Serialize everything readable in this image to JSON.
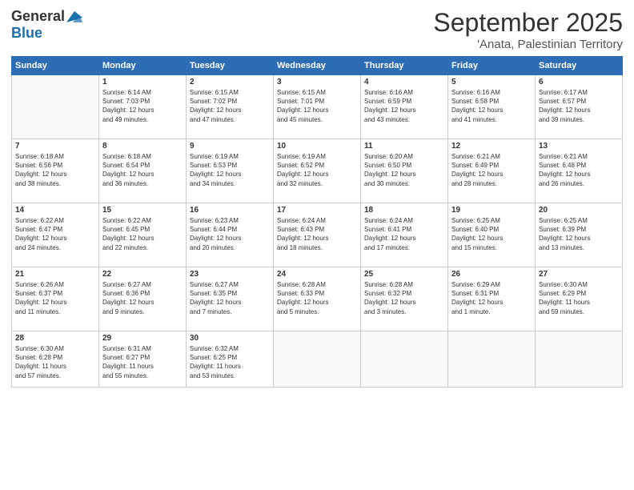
{
  "logo": {
    "general": "General",
    "blue": "Blue"
  },
  "title": "September 2025",
  "location": "'Anata, Palestinian Territory",
  "days_of_week": [
    "Sunday",
    "Monday",
    "Tuesday",
    "Wednesday",
    "Thursday",
    "Friday",
    "Saturday"
  ],
  "weeks": [
    [
      {
        "day": "",
        "info": ""
      },
      {
        "day": "1",
        "info": "Sunrise: 6:14 AM\nSunset: 7:03 PM\nDaylight: 12 hours\nand 49 minutes."
      },
      {
        "day": "2",
        "info": "Sunrise: 6:15 AM\nSunset: 7:02 PM\nDaylight: 12 hours\nand 47 minutes."
      },
      {
        "day": "3",
        "info": "Sunrise: 6:15 AM\nSunset: 7:01 PM\nDaylight: 12 hours\nand 45 minutes."
      },
      {
        "day": "4",
        "info": "Sunrise: 6:16 AM\nSunset: 6:59 PM\nDaylight: 12 hours\nand 43 minutes."
      },
      {
        "day": "5",
        "info": "Sunrise: 6:16 AM\nSunset: 6:58 PM\nDaylight: 12 hours\nand 41 minutes."
      },
      {
        "day": "6",
        "info": "Sunrise: 6:17 AM\nSunset: 6:57 PM\nDaylight: 12 hours\nand 39 minutes."
      }
    ],
    [
      {
        "day": "7",
        "info": "Sunrise: 6:18 AM\nSunset: 6:56 PM\nDaylight: 12 hours\nand 38 minutes."
      },
      {
        "day": "8",
        "info": "Sunrise: 6:18 AM\nSunset: 6:54 PM\nDaylight: 12 hours\nand 36 minutes."
      },
      {
        "day": "9",
        "info": "Sunrise: 6:19 AM\nSunset: 6:53 PM\nDaylight: 12 hours\nand 34 minutes."
      },
      {
        "day": "10",
        "info": "Sunrise: 6:19 AM\nSunset: 6:52 PM\nDaylight: 12 hours\nand 32 minutes."
      },
      {
        "day": "11",
        "info": "Sunrise: 6:20 AM\nSunset: 6:50 PM\nDaylight: 12 hours\nand 30 minutes."
      },
      {
        "day": "12",
        "info": "Sunrise: 6:21 AM\nSunset: 6:49 PM\nDaylight: 12 hours\nand 28 minutes."
      },
      {
        "day": "13",
        "info": "Sunrise: 6:21 AM\nSunset: 6:48 PM\nDaylight: 12 hours\nand 26 minutes."
      }
    ],
    [
      {
        "day": "14",
        "info": "Sunrise: 6:22 AM\nSunset: 6:47 PM\nDaylight: 12 hours\nand 24 minutes."
      },
      {
        "day": "15",
        "info": "Sunrise: 6:22 AM\nSunset: 6:45 PM\nDaylight: 12 hours\nand 22 minutes."
      },
      {
        "day": "16",
        "info": "Sunrise: 6:23 AM\nSunset: 6:44 PM\nDaylight: 12 hours\nand 20 minutes."
      },
      {
        "day": "17",
        "info": "Sunrise: 6:24 AM\nSunset: 6:43 PM\nDaylight: 12 hours\nand 18 minutes."
      },
      {
        "day": "18",
        "info": "Sunrise: 6:24 AM\nSunset: 6:41 PM\nDaylight: 12 hours\nand 17 minutes."
      },
      {
        "day": "19",
        "info": "Sunrise: 6:25 AM\nSunset: 6:40 PM\nDaylight: 12 hours\nand 15 minutes."
      },
      {
        "day": "20",
        "info": "Sunrise: 6:25 AM\nSunset: 6:39 PM\nDaylight: 12 hours\nand 13 minutes."
      }
    ],
    [
      {
        "day": "21",
        "info": "Sunrise: 6:26 AM\nSunset: 6:37 PM\nDaylight: 12 hours\nand 11 minutes."
      },
      {
        "day": "22",
        "info": "Sunrise: 6:27 AM\nSunset: 6:36 PM\nDaylight: 12 hours\nand 9 minutes."
      },
      {
        "day": "23",
        "info": "Sunrise: 6:27 AM\nSunset: 6:35 PM\nDaylight: 12 hours\nand 7 minutes."
      },
      {
        "day": "24",
        "info": "Sunrise: 6:28 AM\nSunset: 6:33 PM\nDaylight: 12 hours\nand 5 minutes."
      },
      {
        "day": "25",
        "info": "Sunrise: 6:28 AM\nSunset: 6:32 PM\nDaylight: 12 hours\nand 3 minutes."
      },
      {
        "day": "26",
        "info": "Sunrise: 6:29 AM\nSunset: 6:31 PM\nDaylight: 12 hours\nand 1 minute."
      },
      {
        "day": "27",
        "info": "Sunrise: 6:30 AM\nSunset: 6:29 PM\nDaylight: 11 hours\nand 59 minutes."
      }
    ],
    [
      {
        "day": "28",
        "info": "Sunrise: 6:30 AM\nSunset: 6:28 PM\nDaylight: 11 hours\nand 57 minutes."
      },
      {
        "day": "29",
        "info": "Sunrise: 6:31 AM\nSunset: 6:27 PM\nDaylight: 11 hours\nand 55 minutes."
      },
      {
        "day": "30",
        "info": "Sunrise: 6:32 AM\nSunset: 6:25 PM\nDaylight: 11 hours\nand 53 minutes."
      },
      {
        "day": "",
        "info": ""
      },
      {
        "day": "",
        "info": ""
      },
      {
        "day": "",
        "info": ""
      },
      {
        "day": "",
        "info": ""
      }
    ]
  ]
}
